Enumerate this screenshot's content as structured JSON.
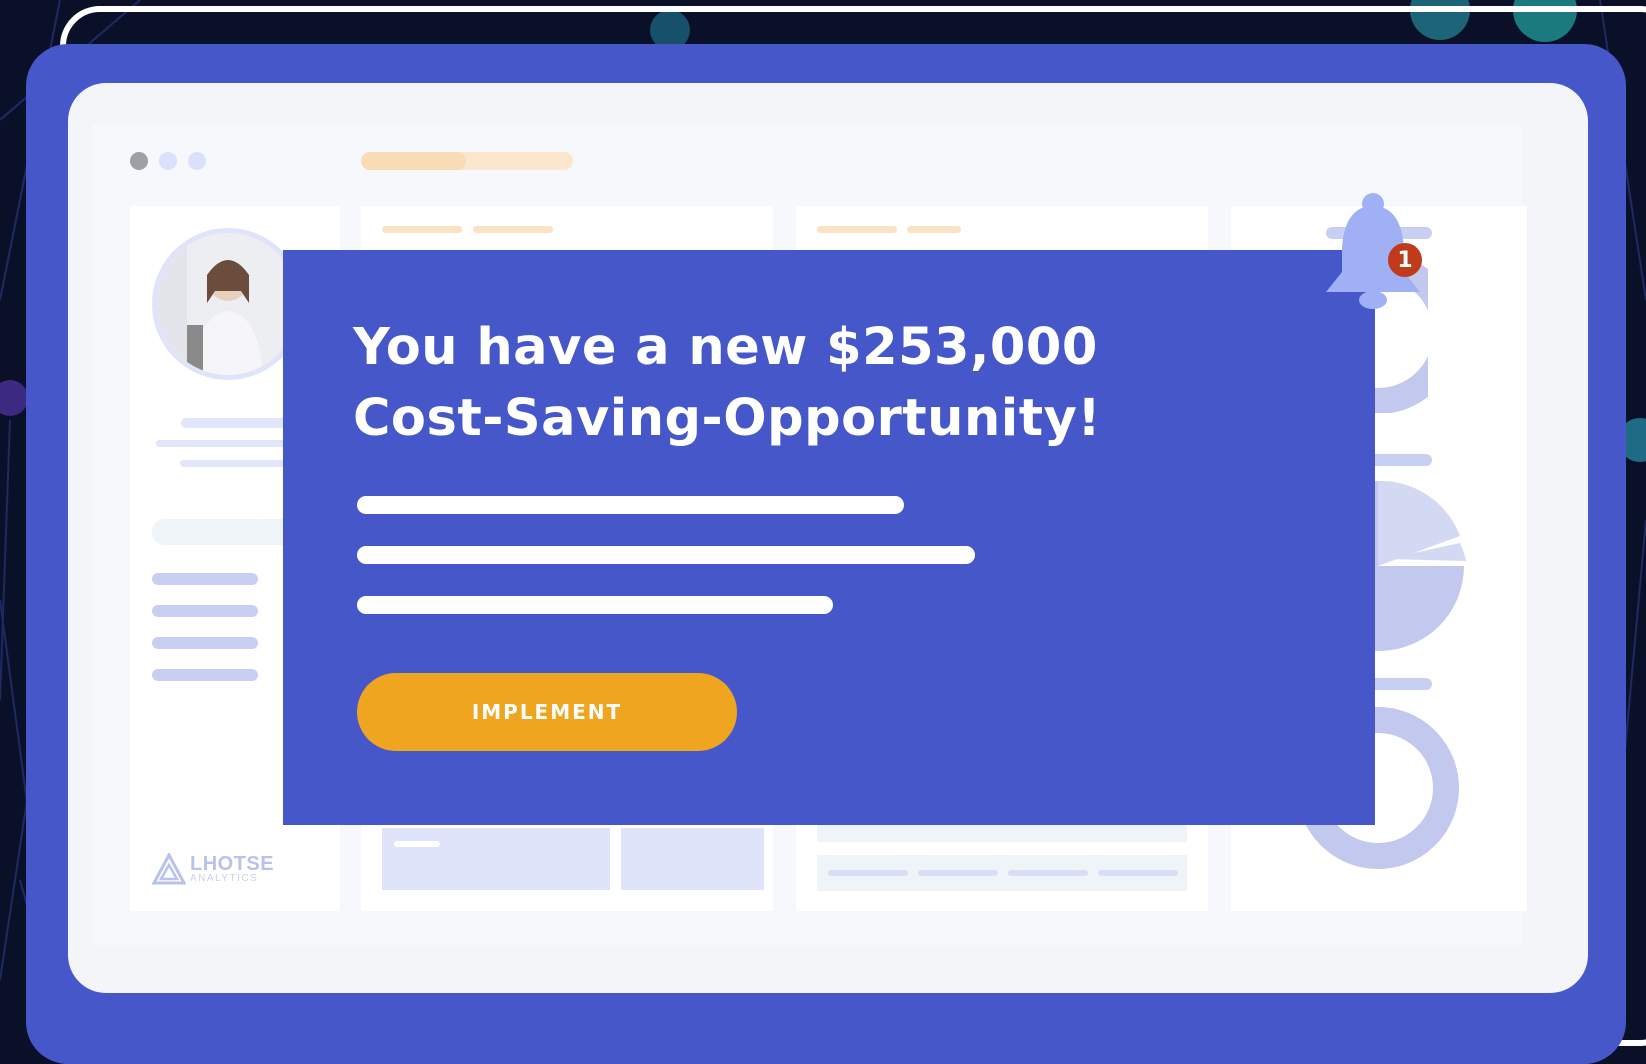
{
  "window": {
    "title_dots": [
      "close",
      "minimize",
      "maximize"
    ]
  },
  "profile": {
    "avatar_icon": "person-photo"
  },
  "brand": {
    "logo_icon": "lhotse-triangle-logo",
    "name": "LHOTSE",
    "sub": "ANALYTICS"
  },
  "notification": {
    "icon": "bell-icon",
    "count": "1"
  },
  "modal": {
    "title_line1": "You have a new $253,000",
    "title_line2": "Cost-Saving-Opportunity!",
    "button_label": "IMPLEMENT"
  },
  "colors": {
    "frame_blue": "#4658c9",
    "button_orange": "#efa51f",
    "badge_red": "#c03a1c",
    "background_dark": "#0b1029"
  }
}
